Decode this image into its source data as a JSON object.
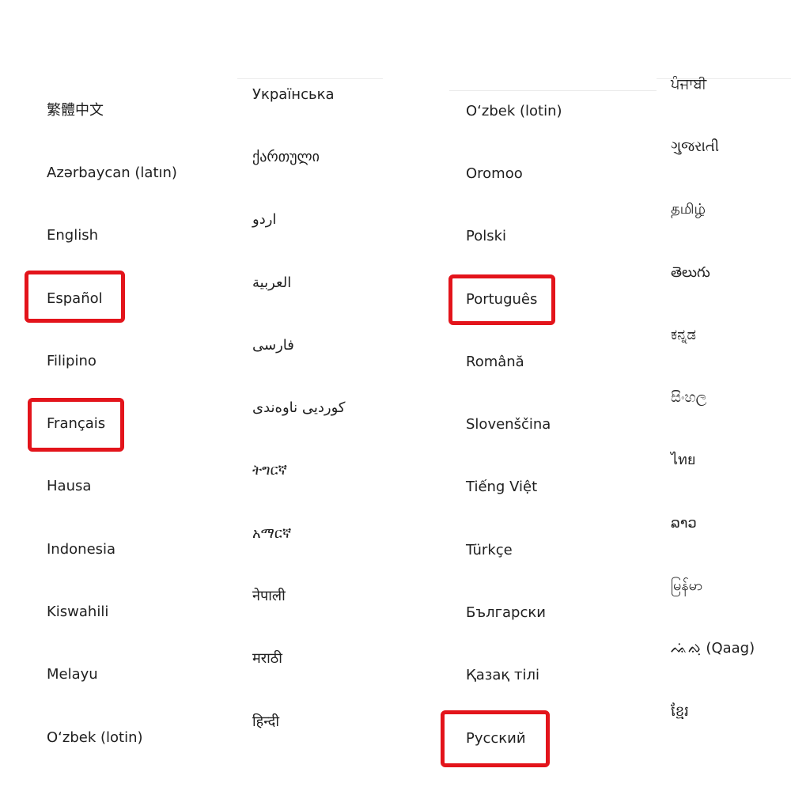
{
  "columns": [
    {
      "languages": [
        "繁體中文",
        "Azərbaycan (latın)",
        "English",
        "Español",
        "Filipino",
        "Français",
        "Hausa",
        "Indonesia",
        "Kiswahili",
        "Melayu",
        "O‘zbek (lotin)"
      ]
    },
    {
      "languages": [
        "Українська",
        "ქართული",
        "اردو",
        "العربية",
        "فارسی",
        "کوردیی ناوەندی",
        "ትግርኛ",
        "አማርኛ",
        "नेपाली",
        "मराठी",
        "हिन्दी"
      ]
    },
    {
      "languages": [
        "O‘zbek (lotin)",
        "Oromoo",
        "Polski",
        "Português",
        "Română",
        "Slovenščina",
        "Tiếng Việt",
        "Türkçe",
        "Български",
        "Қазақ тілі",
        "Русский"
      ]
    },
    {
      "languages": [
        "ਪੰਜਾਬੀ",
        "ગુજરાતી",
        "தமிழ்",
        "తెలుగు",
        "ಕನ್ನಡ",
        "සිංහල",
        "ไทย",
        "ລາວ",
        "မြန်မာ",
        "ᨕᨗᨁᨘ (Qaag)",
        "ខ្មែរ"
      ]
    }
  ],
  "highlighted": [
    "Español",
    "Français",
    "Português",
    "Русский"
  ],
  "colors": {
    "highlight_border": "#e3141b",
    "text": "#202020",
    "background": "#ffffff"
  }
}
